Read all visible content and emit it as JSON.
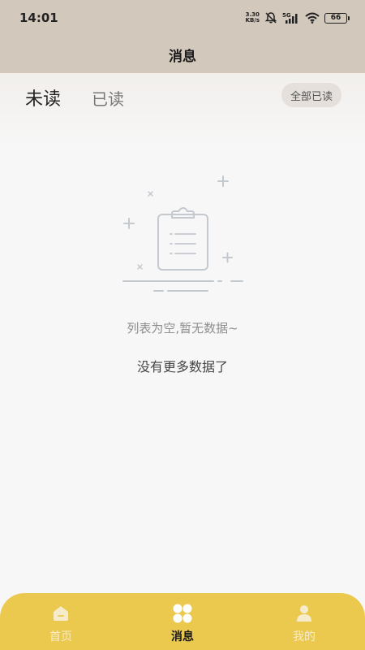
{
  "status_bar": {
    "time": "14:01",
    "net_speed_value": "3.30",
    "net_speed_unit": "KB/s",
    "network_type": "5G",
    "battery": "66",
    "icons": [
      "mute-bell-icon",
      "signal-icon",
      "wifi-icon",
      "battery-icon"
    ]
  },
  "nav": {
    "title": "消息"
  },
  "tabs": {
    "unread": "未读",
    "read": "已读",
    "mark_all_read": "全部已读"
  },
  "empty_state": {
    "icon": "clipboard-empty-icon",
    "message": "列表为空,暂无数据~",
    "no_more": "没有更多数据了"
  },
  "bottom_tabs": [
    {
      "label": "首页",
      "icon": "home-icon",
      "active": false
    },
    {
      "label": "消息",
      "icon": "clover-grid-icon",
      "active": true
    },
    {
      "label": "我的",
      "icon": "person-icon",
      "active": false
    }
  ],
  "colors": {
    "header_bg": "#d2c8bb",
    "tab_bar_bg": "#ebc94f",
    "page_bg": "#f7f7f7"
  }
}
